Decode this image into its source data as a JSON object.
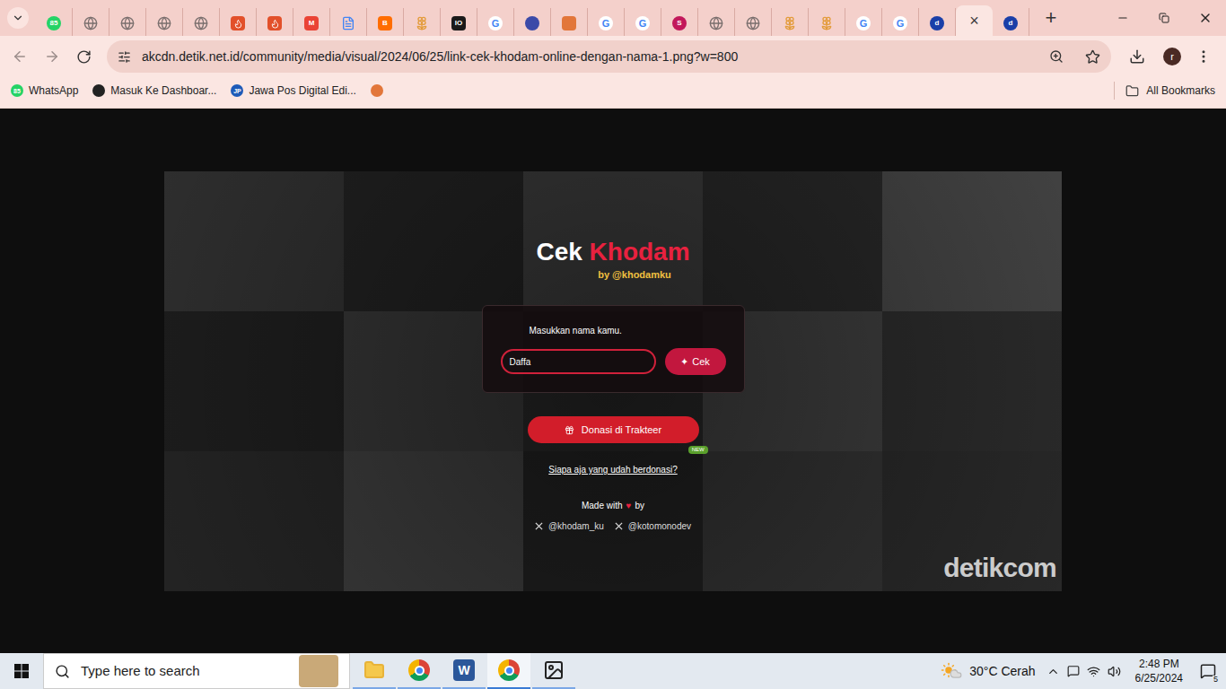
{
  "browser": {
    "tabs": [
      {
        "kind": "badge",
        "glyph": "85",
        "color": "#25d366",
        "selected": false
      },
      {
        "kind": "globe",
        "glyph": "",
        "color": "#7a6f6e",
        "selected": false
      },
      {
        "kind": "globe",
        "glyph": "",
        "color": "#7a6f6e",
        "selected": false
      },
      {
        "kind": "globe",
        "glyph": "",
        "color": "#7a6f6e",
        "selected": false
      },
      {
        "kind": "globe",
        "glyph": "",
        "color": "#7a6f6e",
        "selected": false
      },
      {
        "kind": "flame",
        "glyph": "",
        "color": "#e2502a",
        "selected": false
      },
      {
        "kind": "flame",
        "glyph": "",
        "color": "#e2502a",
        "selected": false
      },
      {
        "kind": "square",
        "glyph": "M",
        "color": "#ea4335",
        "selected": false
      },
      {
        "kind": "docs",
        "glyph": "",
        "color": "#4285f4",
        "selected": false
      },
      {
        "kind": "square",
        "glyph": "B",
        "color": "#ff6d00",
        "selected": false
      },
      {
        "kind": "flower",
        "glyph": "",
        "color": "#e39b3a",
        "selected": false
      },
      {
        "kind": "square",
        "glyph": "IO",
        "color": "#1a1a1a",
        "selected": false
      },
      {
        "kind": "google",
        "glyph": "G",
        "color": "#4285f4",
        "selected": false
      },
      {
        "kind": "badge",
        "glyph": "",
        "color": "#3b4aa8",
        "selected": false
      },
      {
        "kind": "square",
        "glyph": "",
        "color": "#e2763a",
        "selected": false
      },
      {
        "kind": "google",
        "glyph": "G",
        "color": "#4285f4",
        "selected": false
      },
      {
        "kind": "google",
        "glyph": "G",
        "color": "#4285f4",
        "selected": false
      },
      {
        "kind": "badge",
        "glyph": "S",
        "color": "#c2185b",
        "selected": false
      },
      {
        "kind": "globe",
        "glyph": "",
        "color": "#7a6f6e",
        "selected": false
      },
      {
        "kind": "globe",
        "glyph": "",
        "color": "#7a6f6e",
        "selected": false
      },
      {
        "kind": "flower",
        "glyph": "",
        "color": "#e39b3a",
        "selected": false
      },
      {
        "kind": "flower",
        "glyph": "",
        "color": "#e39b3a",
        "selected": false
      },
      {
        "kind": "google",
        "glyph": "G",
        "color": "#4285f4",
        "selected": false
      },
      {
        "kind": "google",
        "glyph": "G",
        "color": "#4285f4",
        "selected": false
      },
      {
        "kind": "badge",
        "glyph": "d",
        "color": "#1a3fa8",
        "selected": false
      },
      {
        "kind": "close",
        "glyph": "×",
        "color": "#3c3c3c",
        "selected": true
      },
      {
        "kind": "badge",
        "glyph": "d",
        "color": "#1a3fa8",
        "selected": false
      }
    ],
    "new_tab": "+",
    "address": "akcdn.detik.net.id/community/media/visual/2024/06/25/link-cek-khodam-online-dengan-nama-1.png?w=800",
    "profile": "r",
    "bookmarks": [
      {
        "label": "WhatsApp",
        "glyph": "85",
        "color": "#25d366"
      },
      {
        "label": "Masuk Ke Dashboar...",
        "glyph": "",
        "color": "#222222"
      },
      {
        "label": "Jawa Pos Digital Edi...",
        "glyph": "JP",
        "color": "#1e5bb8"
      },
      {
        "label": "",
        "glyph": "",
        "color": "#e2763a"
      }
    ],
    "all_bookmarks": "All Bookmarks"
  },
  "image": {
    "title_a": "Cek",
    "title_b": "Khodam",
    "byline": "by @khodamku",
    "prompt": "Masukkan nama kamu.",
    "input_value": "Daffa",
    "button_icon": "✦",
    "button": "Cek",
    "donate": "Donasi di Trakteer",
    "link": "Siapa aja yang udah berdonasi?",
    "new_badge": "NEW",
    "made_with": "Made with",
    "heart": "♥",
    "by": "by",
    "handles": [
      "@khodam_ku",
      "@kotomonodev"
    ],
    "watermark": "detikcom"
  },
  "taskbar": {
    "search_placeholder": "Type here to search",
    "apps": [
      {
        "kind": "explorer",
        "glyph": "",
        "selected": false
      },
      {
        "kind": "chrome",
        "glyph": "",
        "selected": false
      },
      {
        "kind": "word",
        "glyph": "W",
        "selected": false
      },
      {
        "kind": "chrome",
        "glyph": "",
        "selected": true
      },
      {
        "kind": "photos",
        "glyph": "",
        "selected": false
      }
    ],
    "weather": "30°C Cerah",
    "time": "2:48 PM",
    "date": "6/25/2024",
    "notifications": "5"
  }
}
